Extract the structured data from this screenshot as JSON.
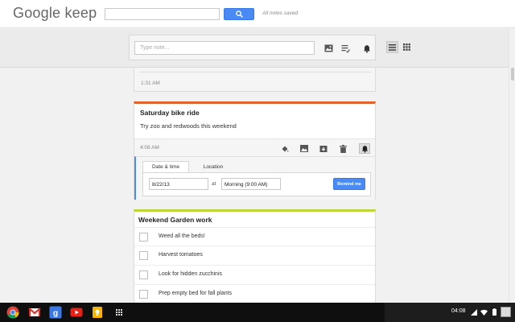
{
  "header": {
    "logo_google": "Google",
    "logo_keep": "keep",
    "search_value": "",
    "saved_status": "All notes saved"
  },
  "compose": {
    "placeholder": "Type note...",
    "icons": [
      "image-icon",
      "list-icon",
      "reminder-bell-icon"
    ]
  },
  "view_toggle": {
    "options": [
      "list-view-icon",
      "grid-view-icon"
    ],
    "selected": "list"
  },
  "notes": [
    {
      "timestamp": "1:31 AM"
    },
    {
      "title": "Saturday bike ride",
      "body": "Try zoo and redwoods this weekend",
      "timestamp": "4:08 AM",
      "color": "#e0622c",
      "reminder": {
        "tabs": [
          "Date & time",
          "Location"
        ],
        "active_tab": "Date & time",
        "date": "8/22/13",
        "at_label": "at",
        "time": "Morning (9:00 AM)",
        "button": "Remind me"
      }
    },
    {
      "title": "Weekend Garden work",
      "color": "#bfd736",
      "items": [
        "Weed all the beds!",
        "Harvest tomatoes",
        "Look for hidden zucchinis",
        "Prep empty bed for fall plants"
      ]
    }
  ],
  "shelf": {
    "apps": [
      "chrome-icon",
      "gmail-icon",
      "google-search-icon",
      "youtube-icon",
      "keep-icon",
      "app-launcher-icon"
    ],
    "clock": "04:08"
  },
  "colors": {
    "accent": "#4a8af4",
    "bike_note": "#e0622c",
    "garden_note": "#bfd736"
  }
}
